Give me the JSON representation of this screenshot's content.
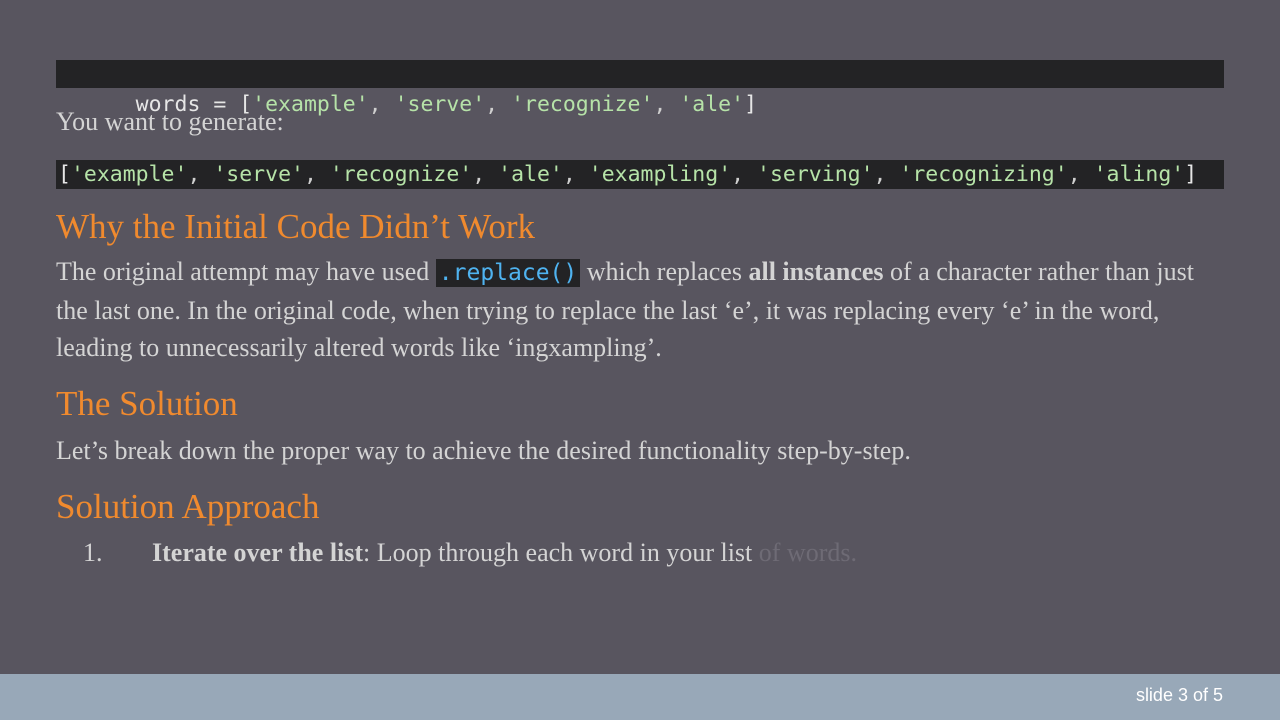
{
  "code1": {
    "prefix": "words = [",
    "items": [
      "'example'",
      "'serve'",
      "'recognize'",
      "'ale'"
    ],
    "sep": ", ",
    "suffix": "]"
  },
  "generate_text": "You want to generate:",
  "code2": {
    "prefix": "[",
    "items": [
      "'example'",
      "'serve'",
      "'recognize'",
      "'ale'",
      "'exampling'",
      "'serving'",
      "'recognizing'",
      "'aling'"
    ],
    "sep": ", ",
    "suffix": "]"
  },
  "why": {
    "heading": "Why the Initial Code Didn’t Work",
    "text_before_code": "The original attempt may have used ",
    "code": ".replace()",
    "text_after_code": " which replaces ",
    "bold": "all instances",
    "text_end": " of a character rather than just the last one. In the original code, when trying to replace the last ‘e’, it was replacing every ‘e’ in the word, leading to unnecessarily altered words like ‘ingxampling’."
  },
  "solution": {
    "heading": "The Solution",
    "text": "Let’s break down the proper way to achieve the desired functionality step-by-step."
  },
  "approach": {
    "heading": "Solution Approach",
    "items": [
      {
        "number": "1.",
        "bold": "Iterate over the list",
        "text": ": Loop through each word in your list",
        "faded": " of words."
      }
    ]
  },
  "footer": {
    "slide_counter": "slide 3 of 5"
  },
  "colors": {
    "background": "#58555f",
    "heading": "#f08a2e",
    "code_background": "#232325",
    "code_string": "#b6e3a8",
    "inline_code": "#4fb3f0",
    "footer_bar": "#98a8b8"
  }
}
